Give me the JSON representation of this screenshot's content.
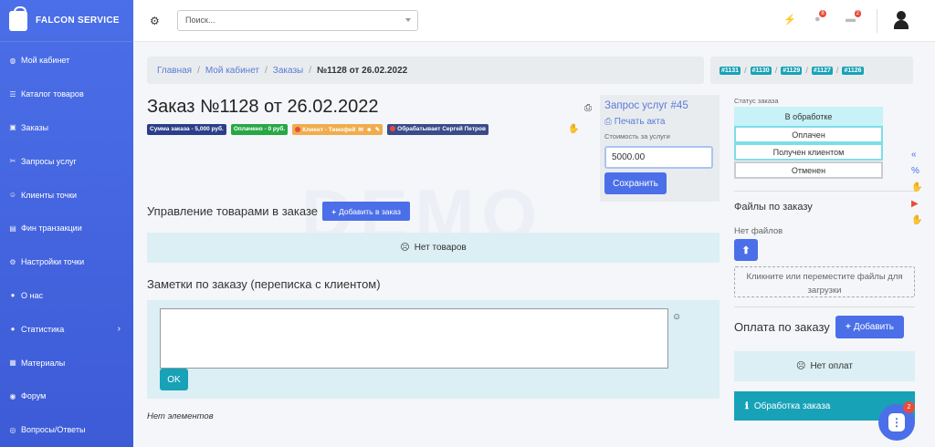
{
  "brand": {
    "name": "FALCON SERVICE",
    "icon": "shopping-bag-icon"
  },
  "sidebar": {
    "items": [
      {
        "label": "Мой кабинет",
        "icon": "dashboard-icon"
      },
      {
        "label": "Каталог товаров",
        "icon": "list-icon"
      },
      {
        "label": "Заказы",
        "icon": "cart-icon"
      },
      {
        "label": "Запросы услуг",
        "icon": "tools-icon"
      },
      {
        "label": "Клиенты точки",
        "icon": "users-icon"
      },
      {
        "label": "Фин транзакции",
        "icon": "money-icon"
      },
      {
        "label": "Настройки точки",
        "icon": "settings-icon"
      },
      {
        "label": "О нас",
        "icon": "info-icon"
      },
      {
        "label": "Статистика",
        "icon": "chart-icon"
      },
      {
        "label": "Материалы",
        "icon": "book-icon"
      },
      {
        "label": "Форум",
        "icon": "forum-icon"
      },
      {
        "label": "Вопросы/Ответы",
        "icon": "question-icon"
      }
    ]
  },
  "topbar": {
    "search_placeholder": "Поиск...",
    "notifications_count": "8",
    "messages_count": "2"
  },
  "breadcrumb": {
    "items": [
      "Главная",
      "Мой кабинет",
      "Заказы"
    ],
    "active": "№1128 от 26.02.2022"
  },
  "order_links": [
    "#1131",
    "#1130",
    "#1129",
    "#1127",
    "#1126"
  ],
  "order": {
    "title": "Заказ №1128 от 26.02.2022",
    "badges": {
      "sum": "Сумма заказа - 5,000 руб.",
      "paid": "Оплачено - 0 руб.",
      "client": "Клиент - Тимофей",
      "handler": "Обрабатывает Сергей Петров"
    }
  },
  "service_request": {
    "title": "Запрос услуг #45",
    "print": "Печать акта",
    "cost_label": "Стоимость за услуги",
    "cost_value": "5000.00",
    "save": "Сохранить"
  },
  "status": {
    "label": "Статус заказа",
    "options": [
      "В обработке",
      "Оплачен",
      "Получен клиентом",
      "Отменен"
    ]
  },
  "files": {
    "title": "Файлы по заказу",
    "empty": "Нет файлов",
    "dropzone": "Кликните или переместите файлы для загрузки"
  },
  "payment": {
    "title": "Оплата по заказу",
    "add": "Добавить",
    "empty": "Нет оплат",
    "process": "Обработка заказа"
  },
  "goods": {
    "title": "Управление товарами в заказе",
    "add": "Добавить в заказ",
    "empty": "Нет товаров"
  },
  "notes": {
    "title": "Заметки по заказу (переписка с клиентом)",
    "ok": "OK",
    "empty": "Нет элементов"
  },
  "chat_badge": "2",
  "watermark": "DEMO"
}
